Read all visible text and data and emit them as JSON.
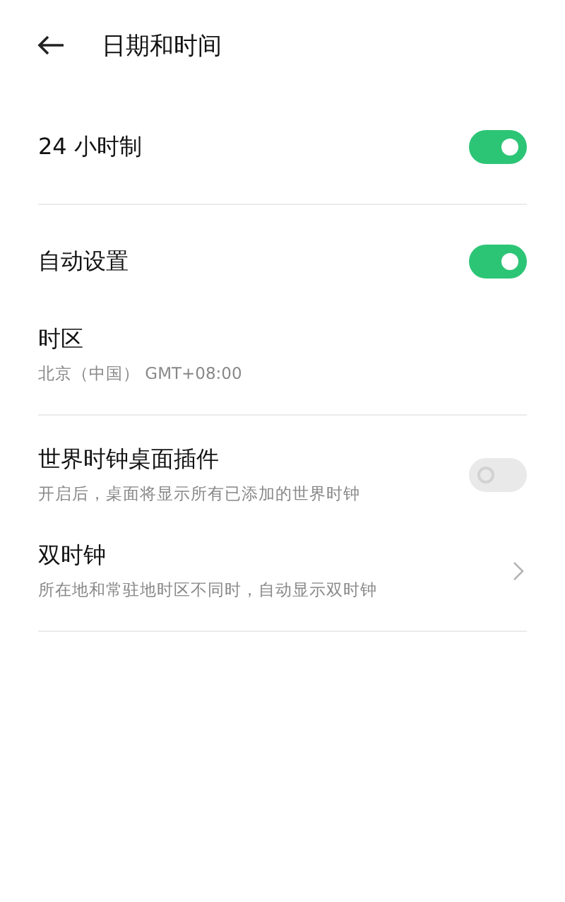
{
  "header": {
    "title": "日期和时间"
  },
  "sections": [
    {
      "items": [
        {
          "kind": "toggle",
          "title": "24 小时制",
          "on": true,
          "disabled": false
        }
      ]
    },
    {
      "items": [
        {
          "kind": "toggle",
          "title": "自动设置",
          "on": true,
          "disabled": false
        },
        {
          "kind": "info",
          "title": "时区",
          "subtitle": "北京（中国） GMT+08:00"
        }
      ]
    },
    {
      "items": [
        {
          "kind": "toggle",
          "title": "世界时钟桌面插件",
          "subtitle": "开启后，桌面将显示所有已添加的世界时钟",
          "on": false,
          "disabled": true
        },
        {
          "kind": "link",
          "title": "双时钟",
          "subtitle": "所在地和常驻地时区不同时，自动显示双时钟"
        }
      ]
    }
  ]
}
